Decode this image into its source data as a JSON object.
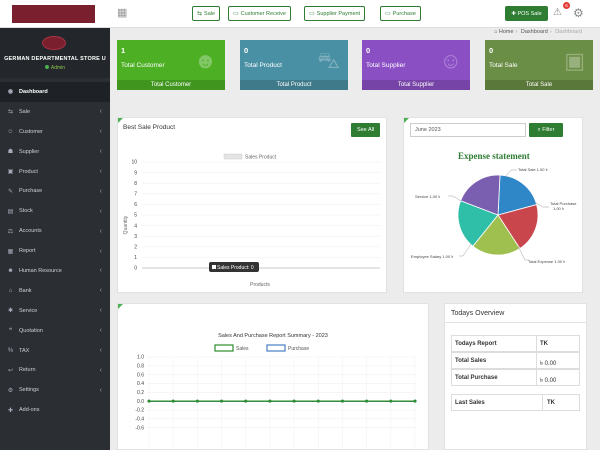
{
  "sidebar": {
    "store_name": "GERMAN DEPARTMENTAL STORE U",
    "status": "Admin",
    "items": [
      {
        "label": "Dashboard",
        "icon": "dashboard-icon",
        "glyph": "◉",
        "chevron": false
      },
      {
        "label": "Sale",
        "icon": "sale-icon",
        "glyph": "⇆",
        "chevron": true
      },
      {
        "label": "Customer",
        "icon": "customer-icon",
        "glyph": "☺",
        "chevron": true
      },
      {
        "label": "Supplier",
        "icon": "supplier-icon",
        "glyph": "☗",
        "chevron": true
      },
      {
        "label": "Product",
        "icon": "product-icon",
        "glyph": "▣",
        "chevron": true
      },
      {
        "label": "Purchase",
        "icon": "purchase-icon",
        "glyph": "✎",
        "chevron": true
      },
      {
        "label": "Stock",
        "icon": "stock-icon",
        "glyph": "▤",
        "chevron": true
      },
      {
        "label": "Accounts",
        "icon": "accounts-icon",
        "glyph": "⚖",
        "chevron": true
      },
      {
        "label": "Report",
        "icon": "report-icon",
        "glyph": "▦",
        "chevron": true
      },
      {
        "label": "Human Resource",
        "icon": "hr-icon",
        "glyph": "☻",
        "chevron": true
      },
      {
        "label": "Bank",
        "icon": "bank-icon",
        "glyph": "⌂",
        "chevron": true
      },
      {
        "label": "Service",
        "icon": "service-icon",
        "glyph": "✱",
        "chevron": true
      },
      {
        "label": "Quotation",
        "icon": "quotation-icon",
        "glyph": "❝",
        "chevron": true
      },
      {
        "label": "TAX",
        "icon": "tax-icon",
        "glyph": "%",
        "chevron": true
      },
      {
        "label": "Return",
        "icon": "return-icon",
        "glyph": "↩",
        "chevron": true
      },
      {
        "label": "Settings",
        "icon": "settings-icon",
        "glyph": "⚙",
        "chevron": true
      },
      {
        "label": "Add-ons",
        "icon": "addons-icon",
        "glyph": "✚",
        "chevron": false
      }
    ]
  },
  "topbar": {
    "sale": "Sale",
    "customer_receive": "Customer Receive",
    "supplier_payment": "Supplier Payment",
    "purchase": "Purchase",
    "pos_sale": "POS Sale",
    "notification_count": "6"
  },
  "breadcrumb": {
    "home": "Home",
    "dashboard": "Dashboard",
    "current": "Dashboard"
  },
  "cards": [
    {
      "num": "1",
      "label": "Total Customer",
      "footer": "Total Customer",
      "color": "#4caf24"
    },
    {
      "num": "0",
      "label": "Total Product",
      "footer": "Total Product",
      "color": "#4a90a4"
    },
    {
      "num": "0",
      "label": "Total Supplier",
      "footer": "Total Supplier",
      "color": "#8b4fc4"
    },
    {
      "num": "0",
      "label": "Total Sale",
      "footer": "Total Sale",
      "color": "#6a8e45"
    }
  ],
  "best_sale": {
    "title": "Best Sale Product",
    "see_all": "See All",
    "legend": "Sales Product",
    "tooltip": "Sales Product: 0",
    "ylabel": "Quantity",
    "xlabel": "Products"
  },
  "expense": {
    "month": "June 2023",
    "filter": "Filter",
    "title": "Expense statement",
    "labels": {
      "total_sale": "Total Sale 1.00 ৳",
      "total_purchase_1": "Total Purchase",
      "total_purchase_2": "1.00 ৳",
      "total_expense": "Total Expense 1.00 ৳",
      "employee_salary": "Employee Salary 1.00 ৳",
      "service": "Service  1.00 ৳"
    }
  },
  "sales_purchase": {
    "title": "Sales And Purchase Report Summary - 2023",
    "legend_sales": "Sales",
    "legend_purchase": "Purchase"
  },
  "overview": {
    "title": "Todays Overview",
    "rows": [
      {
        "label": "Todays Report",
        "value": "TK"
      },
      {
        "label": "Total Sales",
        "value": "৳ 0.00"
      },
      {
        "label": "Total Purchase",
        "value": "৳ 0.00"
      }
    ],
    "last_sales": {
      "label": "Last Sales",
      "value": "TK"
    }
  },
  "chart_data": [
    {
      "type": "bar",
      "title": "",
      "legend": [
        "Sales Product"
      ],
      "xlabel": "Products",
      "ylabel": "Quantity",
      "ylim": [
        0,
        10
      ],
      "yticks": [
        0,
        1,
        2,
        3,
        4,
        5,
        6,
        7,
        8,
        9,
        10
      ],
      "categories": [],
      "series": [
        {
          "name": "Sales Product",
          "values": [
            0
          ]
        }
      ]
    },
    {
      "type": "pie",
      "title": "Expense statement",
      "labels": [
        "Total Sale",
        "Total Purchase",
        "Total Expense",
        "Employee Salary",
        "Service"
      ],
      "values": [
        1,
        1,
        1,
        1,
        1
      ],
      "colors": [
        "#2f87c8",
        "#c9474c",
        "#9fbf4f",
        "#2fbfa8",
        "#7a5fb0"
      ]
    },
    {
      "type": "line",
      "title": "Sales And Purchase Report Summary - 2023",
      "ylim": [
        -1.0,
        1.0
      ],
      "yticks": [
        1.0,
        0.8,
        0.6,
        0.4,
        0.2,
        0,
        -0.2,
        -0.4,
        -0.6
      ],
      "series": [
        {
          "name": "Sales",
          "values": [
            0,
            0,
            0,
            0,
            0,
            0,
            0,
            0,
            0,
            0,
            0,
            0
          ],
          "color": "#2e8b2e"
        },
        {
          "name": "Purchase",
          "values": [
            0,
            0,
            0,
            0,
            0,
            0,
            0,
            0,
            0,
            0,
            0,
            0
          ],
          "color": "#4a7fc4"
        }
      ]
    }
  ]
}
